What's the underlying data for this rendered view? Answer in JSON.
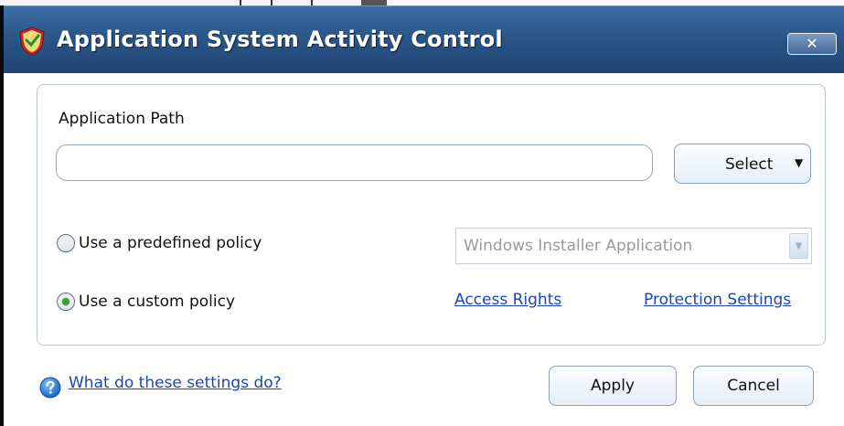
{
  "window": {
    "title": "Application System Activity Control",
    "close_glyph": "✕"
  },
  "form": {
    "path_label": "Application Path",
    "path_value": "",
    "select_label": "Select",
    "select_arrow": "▼",
    "predefined_label": "Use a predefined policy",
    "predefined_selected": false,
    "predefined_value": "Windows Installer Application",
    "combo_arrow": "▼",
    "custom_label": "Use a custom policy",
    "custom_selected": true,
    "access_rights_link": "Access Rights",
    "protection_settings_link": "Protection Settings"
  },
  "footer": {
    "help_link": "What do these settings do?",
    "apply_label": "Apply",
    "cancel_label": "Cancel"
  },
  "colors": {
    "titlebar": "#2b5688",
    "link": "#1a46b8",
    "radio_checked": "#3aa22e"
  },
  "icons": [
    "shield-icon",
    "close-icon",
    "chevron-down-icon",
    "help-icon"
  ]
}
